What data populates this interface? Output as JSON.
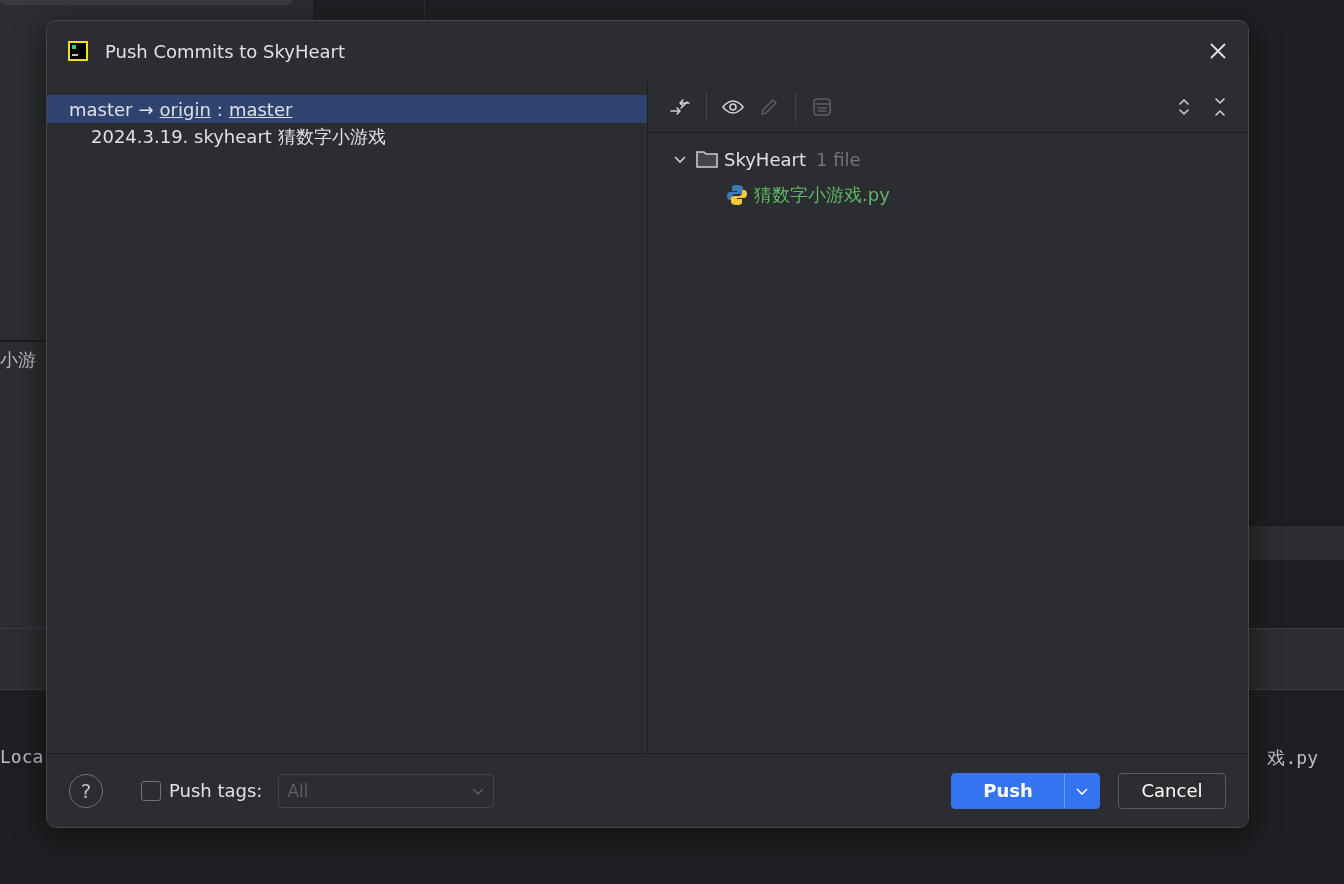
{
  "background": {
    "side_text": "小游",
    "console_left": "Loca",
    "console_right": "戏.py"
  },
  "dialog": {
    "title": "Push Commits to SkyHeart",
    "push_tree": [
      {
        "local": "master",
        "arrow": "→",
        "remote": "origin",
        "separator": ":",
        "remote_branch": "master",
        "selected": true,
        "children": [
          {
            "label": "2024.3.19. skyheart 猜数字小游戏",
            "selected": false
          }
        ]
      }
    ],
    "toolbar": [
      {
        "kind": "diff",
        "disabled": false
      },
      {
        "kind": "sep"
      },
      {
        "kind": "view",
        "disabled": false
      },
      {
        "kind": "edit",
        "disabled": true
      },
      {
        "kind": "sep"
      },
      {
        "kind": "message",
        "disabled": true
      },
      {
        "kind": "spacer"
      },
      {
        "kind": "expand",
        "disabled": false
      },
      {
        "kind": "collapse",
        "disabled": false
      }
    ],
    "files": [
      {
        "name": "SkyHeart",
        "count": "1 file",
        "expanded": true,
        "children": [
          {
            "name": "猜数字小游戏.py",
            "color": "#5fb865"
          }
        ]
      }
    ],
    "footer": {
      "help": "?",
      "push_tags": {
        "label": "Push tags:",
        "checked": false
      },
      "tags_select": {
        "value": "All",
        "disabled": true
      },
      "buttons": [
        {
          "label": "Push",
          "kind": "primary"
        },
        {
          "label": "Cancel",
          "kind": "secondary"
        }
      ]
    }
  }
}
